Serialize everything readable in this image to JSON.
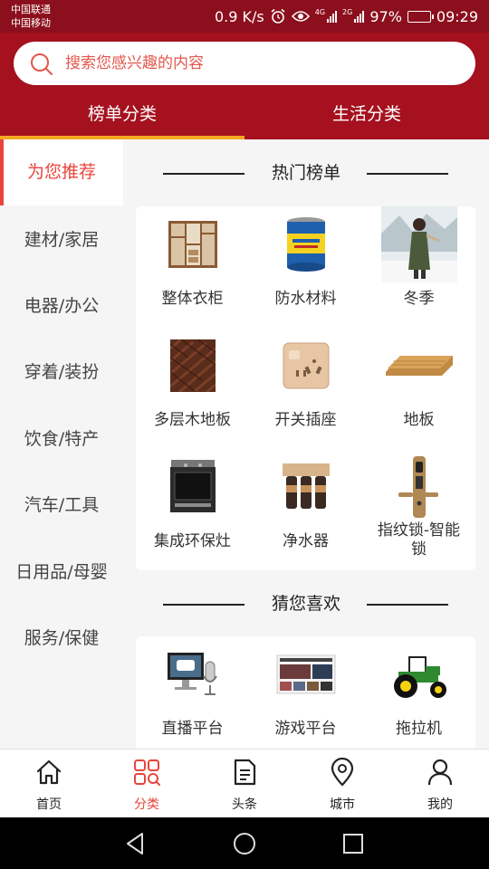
{
  "status_bar": {
    "carrier_1": "中国联通",
    "carrier_2": "中国移动",
    "net_speed": "0.9 K/s",
    "net_4g": "4G",
    "net_2g": "2G",
    "battery": "97%",
    "battery_level": 0.97,
    "time": "09:29"
  },
  "search": {
    "placeholder": "搜索您感兴趣的内容"
  },
  "top_tabs": [
    {
      "label": "榜单分类",
      "active": true
    },
    {
      "label": "生活分类",
      "active": false
    }
  ],
  "sidebar": {
    "items": [
      {
        "label": "为您推荐",
        "active": true
      },
      {
        "label": "建材/家居"
      },
      {
        "label": "电器/办公"
      },
      {
        "label": "穿着/装扮"
      },
      {
        "label": "饮食/特产"
      },
      {
        "label": "汽车/工具"
      },
      {
        "label": "日用品/母婴"
      },
      {
        "label": "服务/保健"
      }
    ]
  },
  "sections": {
    "hot": {
      "title": "热门榜单",
      "items": [
        {
          "label": "整体衣柜",
          "icon": "wardrobe-image"
        },
        {
          "label": "防水材料",
          "icon": "paint-can-image"
        },
        {
          "label": "冬季",
          "icon": "winter-photo-image"
        },
        {
          "label": "多层木地板",
          "icon": "wood-floor-image"
        },
        {
          "label": "开关插座",
          "icon": "socket-image"
        },
        {
          "label": "地板",
          "icon": "plank-image"
        },
        {
          "label": "集成环保灶",
          "icon": "stove-image"
        },
        {
          "label": "净水器",
          "icon": "water-purifier-image"
        },
        {
          "label": "指纹锁-智能锁",
          "icon": "smart-lock-image"
        }
      ]
    },
    "guess": {
      "title": "猜您喜欢",
      "items": [
        {
          "label": "直播平台",
          "icon": "live-stream-image"
        },
        {
          "label": "游戏平台",
          "icon": "game-platform-image"
        },
        {
          "label": "拖拉机",
          "icon": "tractor-image"
        }
      ]
    }
  },
  "bottom_nav": {
    "items": [
      {
        "label": "首页",
        "icon": "home-icon"
      },
      {
        "label": "分类",
        "icon": "category-icon",
        "active": true
      },
      {
        "label": "头条",
        "icon": "headline-icon"
      },
      {
        "label": "城市",
        "icon": "location-icon"
      },
      {
        "label": "我的",
        "icon": "profile-icon"
      }
    ]
  },
  "colors": {
    "header": "#a5111f",
    "status_bar": "#8c0f1d",
    "accent": "#e8453c",
    "tab_indicator": "#f5a623"
  }
}
